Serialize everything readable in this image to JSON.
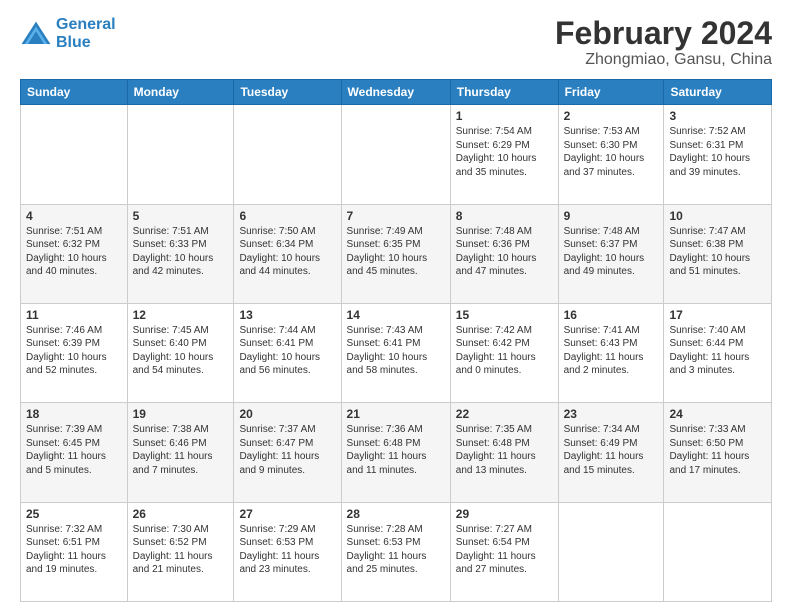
{
  "logo": {
    "line1": "General",
    "line2": "Blue"
  },
  "title": "February 2024",
  "subtitle": "Zhongmiao, Gansu, China",
  "header_days": [
    "Sunday",
    "Monday",
    "Tuesday",
    "Wednesday",
    "Thursday",
    "Friday",
    "Saturday"
  ],
  "weeks": [
    [
      {
        "day": "",
        "info": ""
      },
      {
        "day": "",
        "info": ""
      },
      {
        "day": "",
        "info": ""
      },
      {
        "day": "",
        "info": ""
      },
      {
        "day": "1",
        "info": "Sunrise: 7:54 AM\nSunset: 6:29 PM\nDaylight: 10 hours\nand 35 minutes."
      },
      {
        "day": "2",
        "info": "Sunrise: 7:53 AM\nSunset: 6:30 PM\nDaylight: 10 hours\nand 37 minutes."
      },
      {
        "day": "3",
        "info": "Sunrise: 7:52 AM\nSunset: 6:31 PM\nDaylight: 10 hours\nand 39 minutes."
      }
    ],
    [
      {
        "day": "4",
        "info": "Sunrise: 7:51 AM\nSunset: 6:32 PM\nDaylight: 10 hours\nand 40 minutes."
      },
      {
        "day": "5",
        "info": "Sunrise: 7:51 AM\nSunset: 6:33 PM\nDaylight: 10 hours\nand 42 minutes."
      },
      {
        "day": "6",
        "info": "Sunrise: 7:50 AM\nSunset: 6:34 PM\nDaylight: 10 hours\nand 44 minutes."
      },
      {
        "day": "7",
        "info": "Sunrise: 7:49 AM\nSunset: 6:35 PM\nDaylight: 10 hours\nand 45 minutes."
      },
      {
        "day": "8",
        "info": "Sunrise: 7:48 AM\nSunset: 6:36 PM\nDaylight: 10 hours\nand 47 minutes."
      },
      {
        "day": "9",
        "info": "Sunrise: 7:48 AM\nSunset: 6:37 PM\nDaylight: 10 hours\nand 49 minutes."
      },
      {
        "day": "10",
        "info": "Sunrise: 7:47 AM\nSunset: 6:38 PM\nDaylight: 10 hours\nand 51 minutes."
      }
    ],
    [
      {
        "day": "11",
        "info": "Sunrise: 7:46 AM\nSunset: 6:39 PM\nDaylight: 10 hours\nand 52 minutes."
      },
      {
        "day": "12",
        "info": "Sunrise: 7:45 AM\nSunset: 6:40 PM\nDaylight: 10 hours\nand 54 minutes."
      },
      {
        "day": "13",
        "info": "Sunrise: 7:44 AM\nSunset: 6:41 PM\nDaylight: 10 hours\nand 56 minutes."
      },
      {
        "day": "14",
        "info": "Sunrise: 7:43 AM\nSunset: 6:41 PM\nDaylight: 10 hours\nand 58 minutes."
      },
      {
        "day": "15",
        "info": "Sunrise: 7:42 AM\nSunset: 6:42 PM\nDaylight: 11 hours\nand 0 minutes."
      },
      {
        "day": "16",
        "info": "Sunrise: 7:41 AM\nSunset: 6:43 PM\nDaylight: 11 hours\nand 2 minutes."
      },
      {
        "day": "17",
        "info": "Sunrise: 7:40 AM\nSunset: 6:44 PM\nDaylight: 11 hours\nand 3 minutes."
      }
    ],
    [
      {
        "day": "18",
        "info": "Sunrise: 7:39 AM\nSunset: 6:45 PM\nDaylight: 11 hours\nand 5 minutes."
      },
      {
        "day": "19",
        "info": "Sunrise: 7:38 AM\nSunset: 6:46 PM\nDaylight: 11 hours\nand 7 minutes."
      },
      {
        "day": "20",
        "info": "Sunrise: 7:37 AM\nSunset: 6:47 PM\nDaylight: 11 hours\nand 9 minutes."
      },
      {
        "day": "21",
        "info": "Sunrise: 7:36 AM\nSunset: 6:48 PM\nDaylight: 11 hours\nand 11 minutes."
      },
      {
        "day": "22",
        "info": "Sunrise: 7:35 AM\nSunset: 6:48 PM\nDaylight: 11 hours\nand 13 minutes."
      },
      {
        "day": "23",
        "info": "Sunrise: 7:34 AM\nSunset: 6:49 PM\nDaylight: 11 hours\nand 15 minutes."
      },
      {
        "day": "24",
        "info": "Sunrise: 7:33 AM\nSunset: 6:50 PM\nDaylight: 11 hours\nand 17 minutes."
      }
    ],
    [
      {
        "day": "25",
        "info": "Sunrise: 7:32 AM\nSunset: 6:51 PM\nDaylight: 11 hours\nand 19 minutes."
      },
      {
        "day": "26",
        "info": "Sunrise: 7:30 AM\nSunset: 6:52 PM\nDaylight: 11 hours\nand 21 minutes."
      },
      {
        "day": "27",
        "info": "Sunrise: 7:29 AM\nSunset: 6:53 PM\nDaylight: 11 hours\nand 23 minutes."
      },
      {
        "day": "28",
        "info": "Sunrise: 7:28 AM\nSunset: 6:53 PM\nDaylight: 11 hours\nand 25 minutes."
      },
      {
        "day": "29",
        "info": "Sunrise: 7:27 AM\nSunset: 6:54 PM\nDaylight: 11 hours\nand 27 minutes."
      },
      {
        "day": "",
        "info": ""
      },
      {
        "day": "",
        "info": ""
      }
    ]
  ]
}
